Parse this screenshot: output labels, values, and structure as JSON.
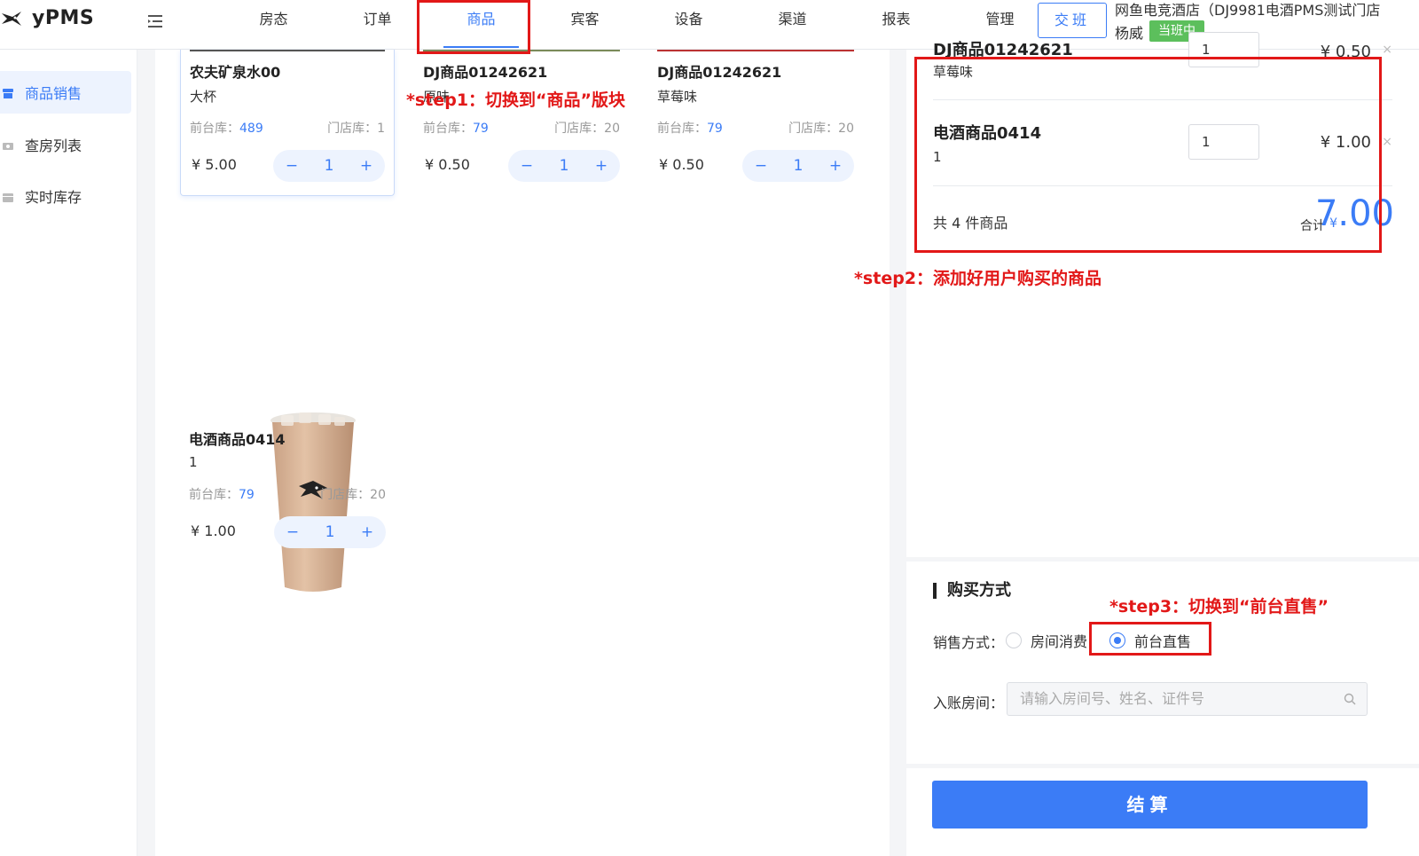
{
  "app": {
    "logo_text": "yPMS"
  },
  "nav": {
    "items": [
      "房态",
      "订单",
      "商品",
      "宾客",
      "设备",
      "渠道",
      "报表",
      "管理"
    ],
    "active": "商品",
    "handover_label": "交班",
    "hotel_name": "网鱼电竞酒店（DJ9981电酒PMS测试门店",
    "user_name": "杨威",
    "shift_status": "当班中"
  },
  "sidebar": {
    "items": [
      {
        "label": "商品销售",
        "icon": "store-icon",
        "active": true
      },
      {
        "label": "查房列表",
        "icon": "camera-icon",
        "active": false
      },
      {
        "label": "实时库存",
        "icon": "box-icon",
        "active": false
      }
    ]
  },
  "products": [
    {
      "name": "农夫矿泉水00",
      "spec": "大杯",
      "front_stock_label": "前台库：",
      "front_stock": "489",
      "store_stock": "门店库：1",
      "price": "¥ 5.00",
      "qty": "1"
    },
    {
      "name": "DJ商品01242621",
      "spec": "原味",
      "front_stock_label": "前台库：",
      "front_stock": "79",
      "store_stock": "门店库：20",
      "price": "¥ 0.50",
      "qty": "1"
    },
    {
      "name": "DJ商品01242621",
      "spec": "草莓味",
      "front_stock_label": "前台库：",
      "front_stock": "79",
      "store_stock": "门店库：20",
      "price": "¥ 0.50",
      "qty": "1"
    },
    {
      "name": "电酒商品0414",
      "spec": "1",
      "front_stock_label": "前台库：",
      "front_stock": "79",
      "store_stock": "门店库：20",
      "price": "¥ 1.00",
      "qty": "1"
    }
  ],
  "cart": {
    "items": [
      {
        "name": "DJ商品01242621",
        "spec": "草莓味",
        "qty": "1",
        "price": "¥ 0.50"
      },
      {
        "name": "电酒商品0414",
        "spec": "1",
        "qty": "1",
        "price": "¥ 1.00"
      }
    ],
    "count_text": "共 4 件商品",
    "total_label": "合计",
    "currency": "¥",
    "total": "7.00",
    "remove_symbol": "×"
  },
  "purchase": {
    "title": "购买方式",
    "sale_method_label": "销售方式：",
    "options": [
      "房间消费",
      "前台直售"
    ],
    "selected": "前台直售",
    "room_label": "入账房间：",
    "room_placeholder": "请输入房间号、姓名、证件号",
    "checkout_label": "结算"
  },
  "annotations": {
    "step1": "*step1：切换到“商品”版块",
    "step2": "*step2：添加好用户购买的商品",
    "step3": "*step3：切换到“前台直售”"
  },
  "colors": {
    "accent": "#3b7cf6",
    "annotation": "#e21818",
    "badge": "#5cbf5c"
  }
}
